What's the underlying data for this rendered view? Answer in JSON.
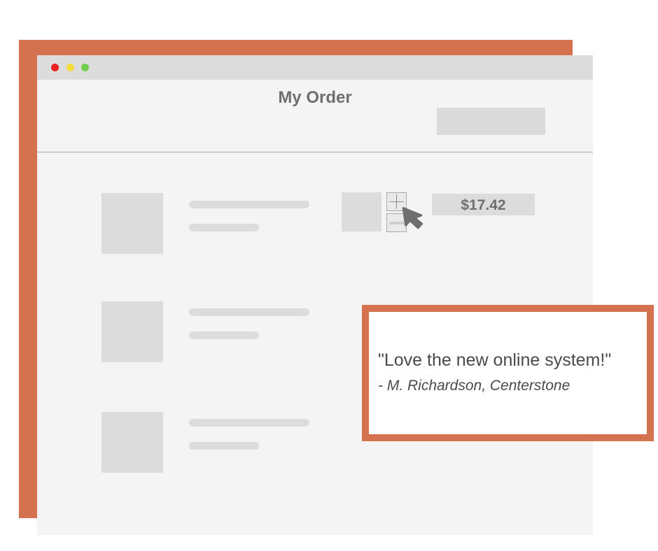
{
  "window": {
    "controls": {
      "close_color": "#ee1f1f",
      "minimize_color": "#f3dd3c",
      "maximize_color": "#71d04b"
    }
  },
  "header": {
    "title": "My Order"
  },
  "order": {
    "items": [
      {
        "quantity_controls": {
          "increment_icon": "plus-icon",
          "decrement_icon": "minus-icon"
        },
        "price": "$17.42"
      },
      {},
      {}
    ]
  },
  "cursor": {
    "icon": "arrow-cursor-icon"
  },
  "testimonial": {
    "quote": "\"Love the new online system!\"",
    "author": "- M. Richardson, Centerstone"
  },
  "colors": {
    "accent": "#d4714f",
    "window_bg": "#f4f4f4",
    "titlebar": "#dcdcdc",
    "placeholder": "#dcdcdc",
    "text": "#6f6f6f"
  }
}
